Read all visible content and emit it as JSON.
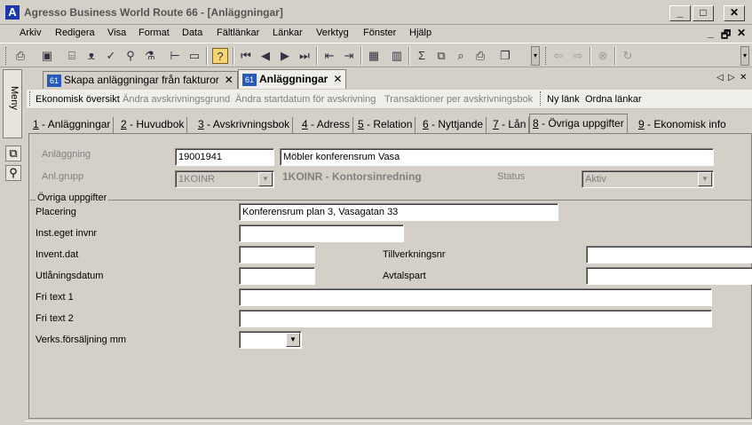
{
  "window": {
    "logo": "A",
    "title": "Agresso Business World Route 66 - [Anläggningar]",
    "minimize": "_",
    "maximize": "□",
    "close": "✕"
  },
  "menu": {
    "items": [
      "Arkiv",
      "Redigera",
      "Visa",
      "Format",
      "Data",
      "Fältlänkar",
      "Länkar",
      "Verktyg",
      "Fönster",
      "Hjälp"
    ],
    "mdi_min": "_",
    "mdi_restore": "🗗",
    "mdi_close": "✕"
  },
  "sidebar": {
    "menu_label": "Meny"
  },
  "doc_tabs": {
    "items": [
      {
        "icon_text": "61",
        "label": "Skapa anläggningar från fakturor",
        "close": "✕"
      },
      {
        "icon_text": "61",
        "label": "Anläggningar",
        "close": "✕"
      }
    ],
    "nav_left": "◁",
    "nav_right": "▷",
    "nav_close": "✕"
  },
  "links": {
    "items": [
      {
        "label": "Ekonomisk översikt",
        "enabled": true
      },
      {
        "label": "Ändra avskrivningsgrund",
        "enabled": false
      },
      {
        "label": "Ändra startdatum för avskrivning",
        "enabled": false
      },
      {
        "label": "Transaktioner per avskrivningsbok",
        "enabled": false
      },
      {
        "label": "Ny länk",
        "enabled": true
      },
      {
        "label": "Ordna länkar",
        "enabled": true
      }
    ]
  },
  "sub_tabs": {
    "items": [
      {
        "key": "1",
        "label": " - Anläggningar"
      },
      {
        "key": "2",
        "label": " - Huvudbok"
      },
      {
        "key": "3",
        "label": " - Avskrivningsbok"
      },
      {
        "key": "4",
        "label": " - Adress"
      },
      {
        "key": "5",
        "label": " - Relation"
      },
      {
        "key": "6",
        "label": " - Nyttjande"
      },
      {
        "key": "7",
        "label": " - Lån"
      },
      {
        "key": "8",
        "label": " - Övriga uppgifter"
      },
      {
        "key": "9",
        "label": " - Ekonomisk info"
      }
    ],
    "active_index": 7
  },
  "header": {
    "anlaggning_label": "Anläggning",
    "anlaggning_value": "19001941",
    "description_value": "Möbler konferensrum Vasa",
    "anlgrupp_label": "Anl.grupp",
    "anlgrupp_value": "1KOINR",
    "anlgrupp_desc": "1KOINR - Kontorsinredning",
    "status_label": "Status",
    "status_value": "Aktiv"
  },
  "group": {
    "title": "Övriga uppgifter",
    "placering_label": "Placering",
    "placering_value": "Konferensrum plan 3, Vasagatan 33",
    "inst_label": "Inst.eget invnr",
    "inst_value": "",
    "invent_label": "Invent.dat",
    "invent_value": "",
    "tillv_label": "Tillverkningsnr",
    "tillv_value": "",
    "utlan_label": "Utlåningsdatum",
    "utlan_value": "",
    "avtal_label": "Avtalspart",
    "avtal_value": "",
    "fritext1_label": "Fri text 1",
    "fritext1_value": "",
    "fritext2_label": "Fri text 2",
    "fritext2_value": "",
    "verks_label": "Verks.försäljning mm",
    "verks_value": ""
  },
  "colors": {
    "chrome": "#d4d0c8",
    "logo_blue": "#1a3aa8"
  }
}
